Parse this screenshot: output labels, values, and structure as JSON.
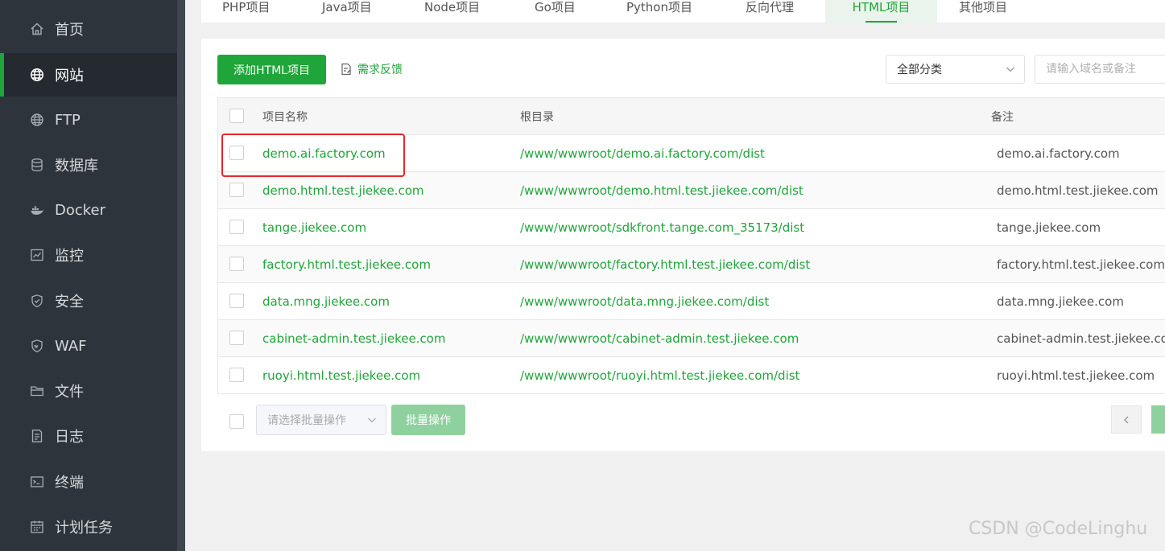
{
  "sidebar": {
    "items": [
      {
        "label": "首页",
        "icon": "home-icon"
      },
      {
        "label": "网站",
        "icon": "globe-icon",
        "active": true
      },
      {
        "label": "FTP",
        "icon": "ftp-globe-icon"
      },
      {
        "label": "数据库",
        "icon": "database-icon"
      },
      {
        "label": "Docker",
        "icon": "docker-icon"
      },
      {
        "label": "监控",
        "icon": "monitor-chart-icon"
      },
      {
        "label": "安全",
        "icon": "shield-icon"
      },
      {
        "label": "WAF",
        "icon": "waf-shield-icon"
      },
      {
        "label": "文件",
        "icon": "folder-icon"
      },
      {
        "label": "日志",
        "icon": "log-document-icon"
      },
      {
        "label": "终端",
        "icon": "terminal-icon"
      },
      {
        "label": "计划任务",
        "icon": "calendar-icon"
      }
    ]
  },
  "tabs": [
    {
      "label": "PHP项目"
    },
    {
      "label": "Java项目"
    },
    {
      "label": "Node项目"
    },
    {
      "label": "Go项目"
    },
    {
      "label": "Python项目"
    },
    {
      "label": "反向代理"
    },
    {
      "label": "HTML项目",
      "active": true
    },
    {
      "label": "其他项目"
    }
  ],
  "toolbar": {
    "add_label": "添加HTML项目",
    "feedback_label": "需求反馈",
    "category_value": "全部分类",
    "search_placeholder": "请输入域名或备注"
  },
  "table": {
    "headers": {
      "name": "项目名称",
      "root": "根目录",
      "note": "备注"
    },
    "rows": [
      {
        "name": "demo.ai.factory.com",
        "root": "/www/wwwroot/demo.ai.factory.com/dist",
        "note": "demo.ai.factory.com"
      },
      {
        "name": "demo.html.test.jiekee.com",
        "root": "/www/wwwroot/demo.html.test.jiekee.com/dist",
        "note": "demo.html.test.jiekee.com"
      },
      {
        "name": "tange.jiekee.com",
        "root": "/www/wwwroot/sdkfront.tange.com_35173/dist",
        "note": "tange.jiekee.com"
      },
      {
        "name": "factory.html.test.jiekee.com",
        "root": "/www/wwwroot/factory.html.test.jiekee.com/dist",
        "note": "factory.html.test.jiekee.com"
      },
      {
        "name": "data.mng.jiekee.com",
        "root": "/www/wwwroot/data.mng.jiekee.com/dist",
        "note": "data.mng.jiekee.com"
      },
      {
        "name": "cabinet-admin.test.jiekee.com",
        "root": "/www/wwwroot/cabinet-admin.test.jiekee.com",
        "note": "cabinet-admin.test.jiekee.com"
      },
      {
        "name": "ruoyi.html.test.jiekee.com",
        "root": "/www/wwwroot/ruoyi.html.test.jiekee.com/dist",
        "note": "ruoyi.html.test.jiekee.com"
      }
    ]
  },
  "footer": {
    "batch_select_placeholder": "请选择批量操作",
    "batch_button_label": "批量操作"
  },
  "watermark": "CSDN @CodeLinghu",
  "colors": {
    "accent": "#20a53a",
    "sidebar_bg": "#2e343c",
    "highlight": "#e8282b"
  }
}
